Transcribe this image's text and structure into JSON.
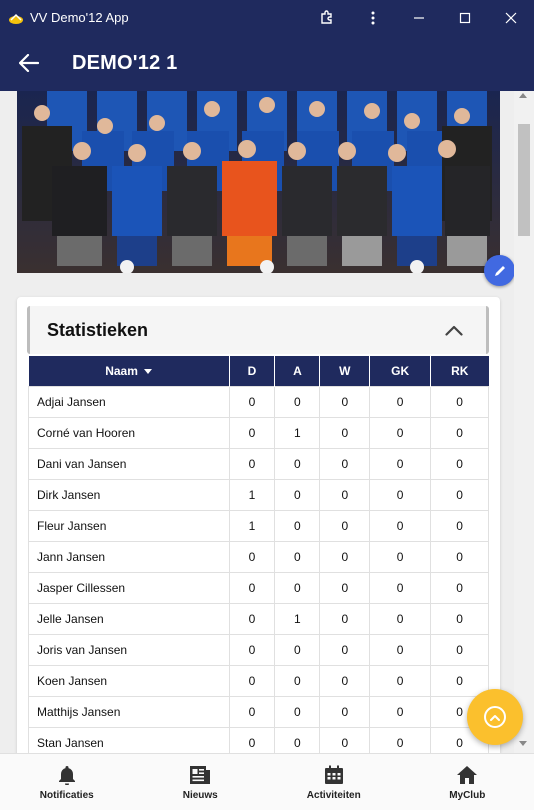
{
  "window": {
    "app_title": "VV Demo'12 App"
  },
  "appbar": {
    "title": "DEMO'12 1"
  },
  "stats": {
    "title": "Statistieken",
    "columns": [
      "Naam",
      "D",
      "A",
      "W",
      "GK",
      "RK"
    ],
    "rows": [
      {
        "name": "Adjai Jansen",
        "d": "0",
        "a": "0",
        "w": "0",
        "gk": "0",
        "rk": "0"
      },
      {
        "name": "Corné van Hooren",
        "d": "0",
        "a": "1",
        "w": "0",
        "gk": "0",
        "rk": "0"
      },
      {
        "name": "Dani van Jansen",
        "d": "0",
        "a": "0",
        "w": "0",
        "gk": "0",
        "rk": "0"
      },
      {
        "name": "Dirk Jansen",
        "d": "1",
        "a": "0",
        "w": "0",
        "gk": "0",
        "rk": "0"
      },
      {
        "name": "Fleur Jansen",
        "d": "1",
        "a": "0",
        "w": "0",
        "gk": "0",
        "rk": "0"
      },
      {
        "name": "Jann Jansen",
        "d": "0",
        "a": "0",
        "w": "0",
        "gk": "0",
        "rk": "0"
      },
      {
        "name": "Jasper Cillessen",
        "d": "0",
        "a": "0",
        "w": "0",
        "gk": "0",
        "rk": "0"
      },
      {
        "name": "Jelle Jansen",
        "d": "0",
        "a": "1",
        "w": "0",
        "gk": "0",
        "rk": "0"
      },
      {
        "name": "Joris van Jansen",
        "d": "0",
        "a": "0",
        "w": "0",
        "gk": "0",
        "rk": "0"
      },
      {
        "name": "Koen Jansen",
        "d": "0",
        "a": "0",
        "w": "0",
        "gk": "0",
        "rk": "0"
      },
      {
        "name": "Matthijs Jansen",
        "d": "0",
        "a": "0",
        "w": "0",
        "gk": "0",
        "rk": "0"
      },
      {
        "name": "Stan Jansen",
        "d": "0",
        "a": "0",
        "w": "0",
        "gk": "0",
        "rk": "0"
      }
    ]
  },
  "bottomnav": {
    "items": [
      {
        "label": "Notificaties",
        "icon": "bell-icon"
      },
      {
        "label": "Nieuws",
        "icon": "newspaper-icon"
      },
      {
        "label": "Activiteiten",
        "icon": "calendar-icon"
      },
      {
        "label": "MyClub",
        "icon": "home-icon"
      }
    ]
  },
  "colors": {
    "primary": "#1f2a5e",
    "accent_fab": "#fbc02d",
    "edit_fab": "#4169e1"
  }
}
